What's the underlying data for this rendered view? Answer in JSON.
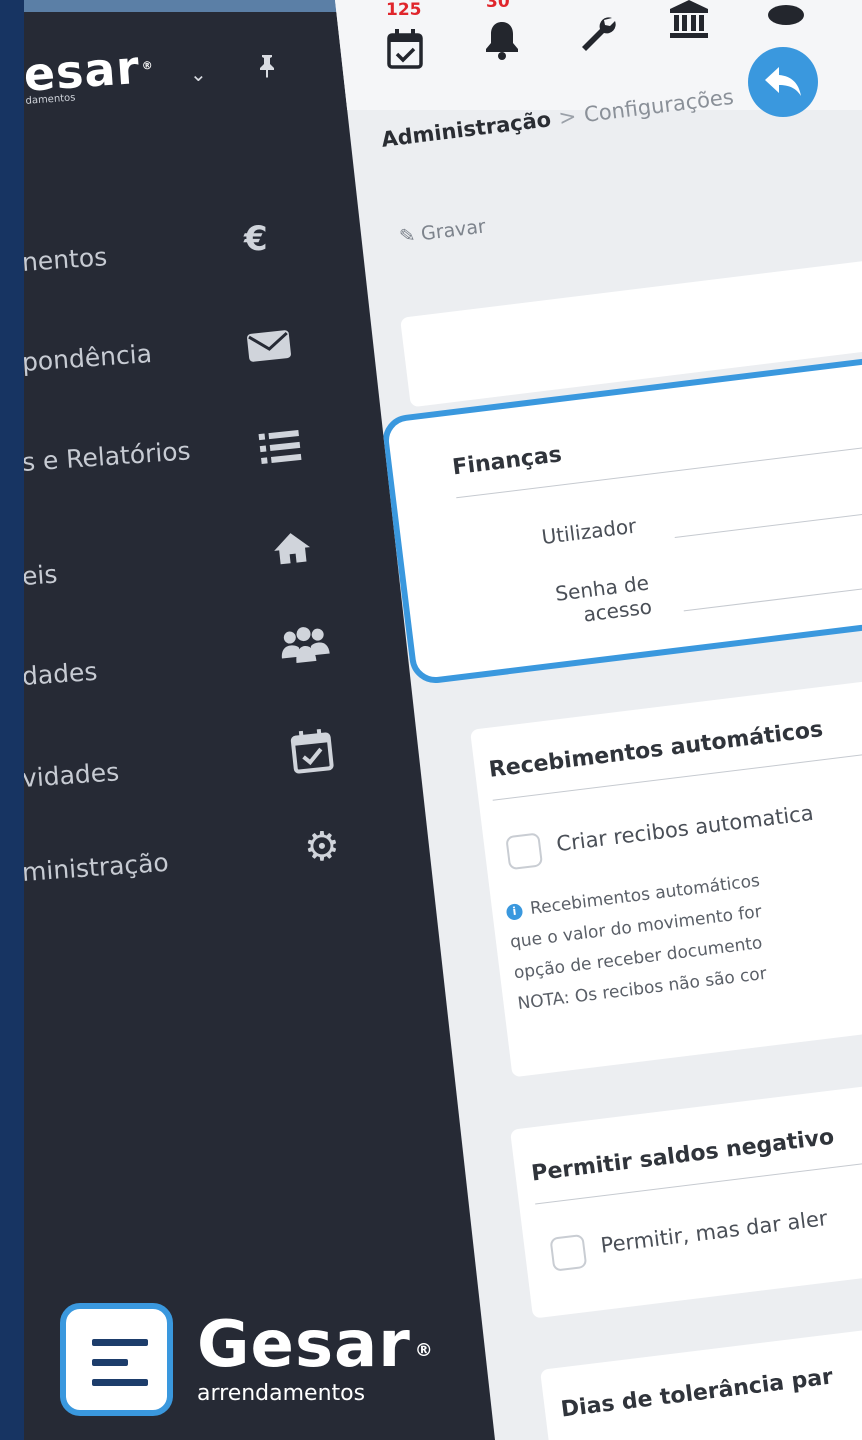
{
  "sidebar": {
    "brand": "esar",
    "brand_sub": "damentos",
    "brand_reg": "®",
    "chevron": "⌄",
    "items": [
      {
        "label": "nentos",
        "icon": "euro-icon"
      },
      {
        "label": "pondência",
        "icon": "envelope-icon"
      },
      {
        "label": "s e Relatórios",
        "icon": "list-icon"
      },
      {
        "label": "eis",
        "icon": "home-icon"
      },
      {
        "label": "dades",
        "icon": "users-icon"
      },
      {
        "label": "vidades",
        "icon": "calendar-check-icon"
      },
      {
        "label": "ministração",
        "icon": "gear-icon"
      }
    ]
  },
  "topbar": {
    "calendar_badge": "125",
    "bell_badge": "30",
    "icons": [
      "calendar-check-icon",
      "bell-icon",
      "wrench-icon",
      "bank-icon",
      "user-icon"
    ]
  },
  "breadcrumb": {
    "root": "Administração",
    "separator": ">",
    "current": "Configurações"
  },
  "toolbar": {
    "save_label": "Gravar"
  },
  "financas": {
    "title": "Finanças",
    "user_label": "Utilizador",
    "password_label_line1": "Senha de",
    "password_label_line2": "acesso"
  },
  "recebimentos": {
    "title": "Recebimentos automáticos",
    "checkbox_label": "Criar recibos automatica",
    "info_lines": [
      "Recebimentos automáticos",
      "que o valor do movimento for",
      "opção de receber documento",
      "NOTA: Os recibos não são cor"
    ]
  },
  "saldos": {
    "title": "Permitir saldos negativo",
    "checkbox_label": "Permitir, mas dar aler"
  },
  "tolerancia": {
    "title": "Dias de tolerância par"
  },
  "logo": {
    "name": "Gesar",
    "reg": "®",
    "sub": "arrendamentos"
  },
  "colors": {
    "accent": "#3a98de",
    "sidebar_bg": "#262a35",
    "brand_navy": "#1d3d6b",
    "badge_red": "#e0262c"
  }
}
